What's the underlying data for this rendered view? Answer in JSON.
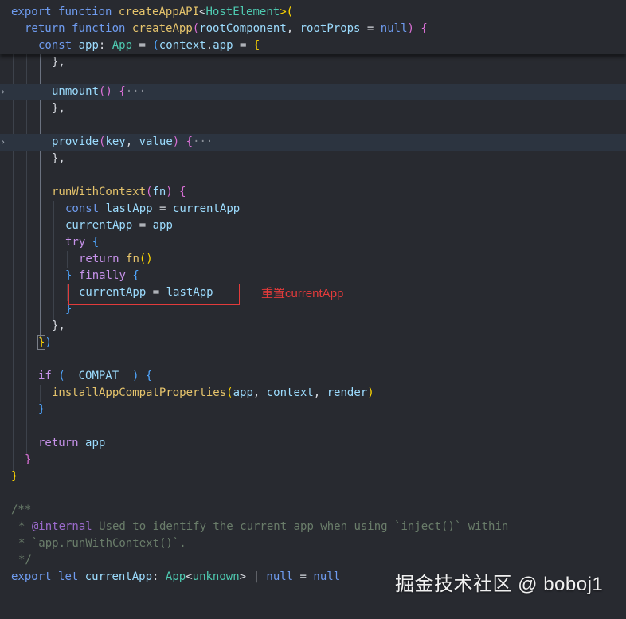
{
  "code": {
    "l1": [
      "export",
      "function",
      "createAppAPI",
      "<",
      "HostElement",
      ">("
    ],
    "l2": [
      "return",
      "function",
      "createApp",
      "(",
      "rootComponent",
      ", ",
      "rootProps",
      " = ",
      "null",
      ") ",
      "{"
    ],
    "l3": [
      "const",
      "app",
      ": ",
      "App",
      " = ",
      "(",
      "context",
      ".",
      "app",
      " = ",
      "{"
    ],
    "l4": "},",
    "l5": [
      "unmount",
      "() ",
      "{",
      "···"
    ],
    "l6": "},",
    "l7": [
      "provide",
      "(",
      "key",
      ", ",
      "value",
      ") ",
      "{",
      "···"
    ],
    "l8": "},",
    "l9": [
      "runWithContext",
      "(",
      "fn",
      ") ",
      "{"
    ],
    "l10": [
      "const",
      "lastApp",
      " = ",
      "currentApp"
    ],
    "l11": [
      "currentApp",
      " = ",
      "app"
    ],
    "l12": [
      "try",
      "{"
    ],
    "l13": [
      "return",
      "fn",
      "()"
    ],
    "l14": [
      "}",
      "finally",
      "{"
    ],
    "l15": [
      "currentApp",
      " = ",
      "lastApp"
    ],
    "l16": "}",
    "l17": "},",
    "l18": [
      "}",
      ")"
    ],
    "l19": [
      "if",
      "(",
      "__COMPAT__",
      ") ",
      "{"
    ],
    "l20": [
      "installAppCompatProperties",
      "(",
      "app",
      ", ",
      "context",
      ", ",
      "render",
      ")"
    ],
    "l21": "}",
    "l22": [
      "return",
      "app"
    ],
    "l23": "}",
    "l24": "}",
    "l25": "/**",
    "l26": [
      "* ",
      "@internal",
      " Used to identify the current app when using `inject()` within"
    ],
    "l27": "* `app.runWithContext()`.",
    "l28": "*/",
    "l29": [
      "export",
      "let",
      "currentApp",
      ": ",
      "App",
      "<",
      "unknown",
      ">",
      " | ",
      "null",
      " = ",
      "null"
    ]
  },
  "annotation": "重置currentApp",
  "watermark": "掘金技术社区 @ boboj1",
  "fold_icon": "chevron-right-icon",
  "colors": {
    "background": "#282a30",
    "keyword": "#6f9cf0",
    "function": "#e6c46c",
    "variable": "#9cdcfe",
    "type": "#4ec9b0",
    "annotation": "#e23b3b"
  }
}
